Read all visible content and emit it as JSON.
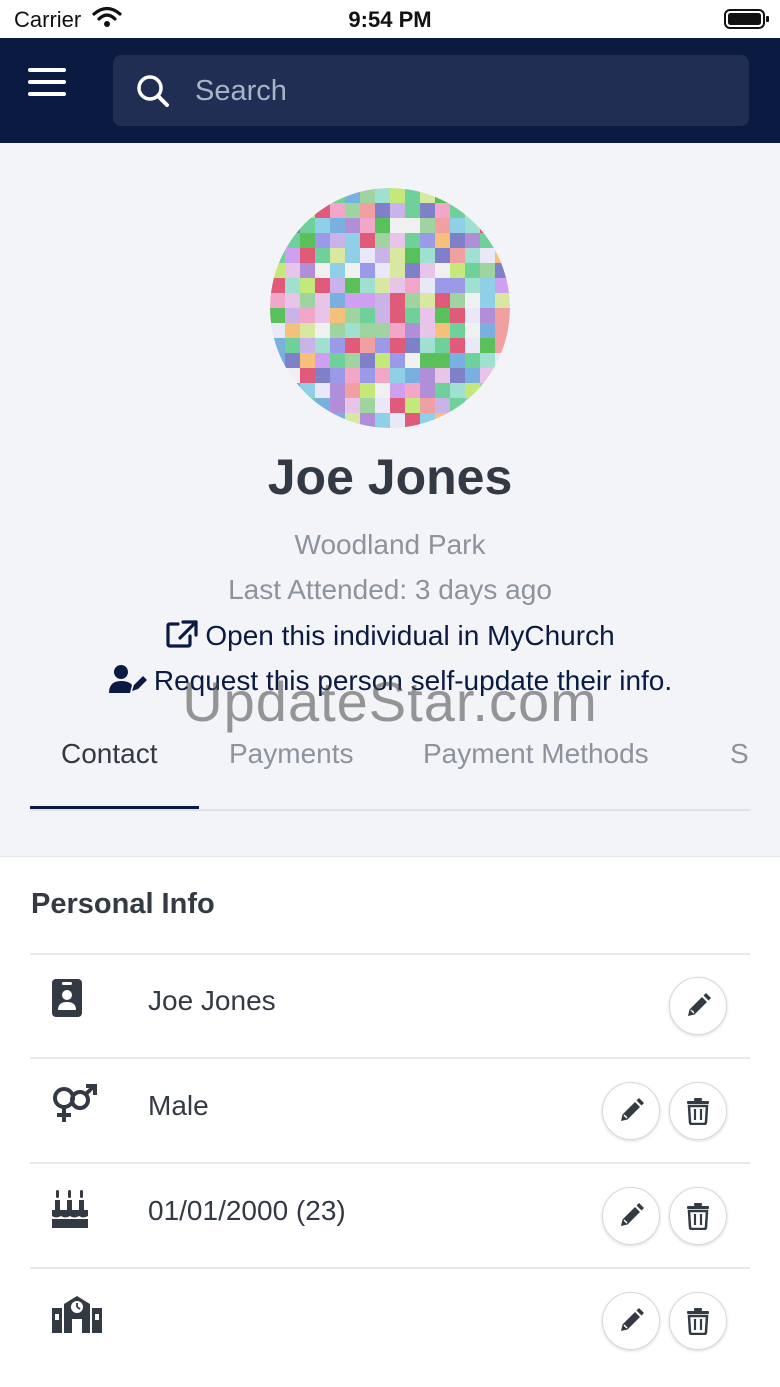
{
  "status_bar": {
    "carrier": "Carrier",
    "time": "9:54 PM"
  },
  "header": {
    "search": {
      "placeholder": "Search"
    }
  },
  "profile": {
    "name": "Joe Jones",
    "campus": "Woodland Park",
    "last_attended": "Last Attended: 3 days ago",
    "open_mychurch_label": "Open this individual in MyChurch",
    "request_update_label": "Request this person self-update their info."
  },
  "watermark": "UpdateStar.com",
  "tabs": [
    {
      "label": "Contact",
      "active": true
    },
    {
      "label": "Payments",
      "active": false
    },
    {
      "label": "Payment Methods",
      "active": false
    },
    {
      "label": "S",
      "active": false
    }
  ],
  "personal_info": {
    "title": "Personal Info",
    "rows": [
      {
        "icon": "id-badge-icon",
        "value": "Joe Jones"
      },
      {
        "icon": "gender-icon",
        "value": "Male"
      },
      {
        "icon": "birthday-cake-icon",
        "value": "01/01/2000 (23)"
      },
      {
        "icon": "school-icon",
        "value": ""
      }
    ]
  },
  "colors": {
    "nav_background": "#0b1a40",
    "search_background": "#1f2e52",
    "profile_background": "#f2f4f7",
    "muted_text": "#8d939c",
    "primary_text": "#333a44"
  }
}
